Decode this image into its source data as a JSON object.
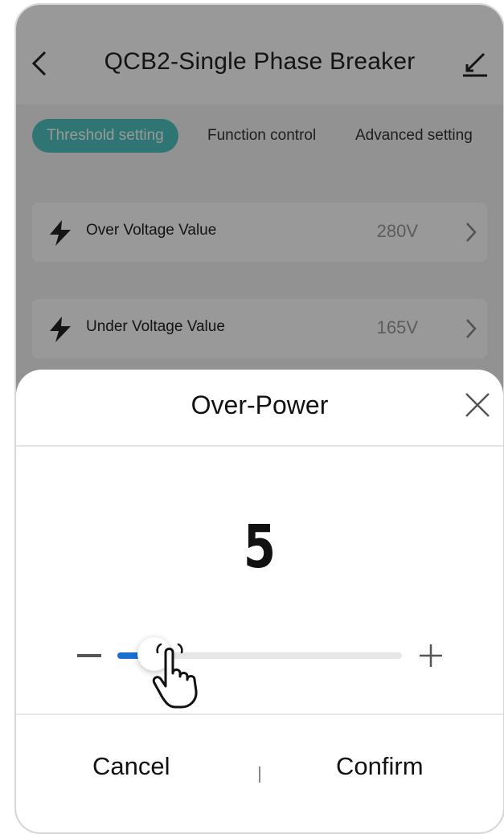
{
  "header": {
    "title": "QCB2-Single Phase Breaker",
    "back_icon": "chevron-left-icon",
    "edit_icon": "edit-pencil-icon"
  },
  "tabs": [
    {
      "label": "Threshold setting",
      "active": true
    },
    {
      "label": "Function control",
      "active": false
    },
    {
      "label": "Advanced setting",
      "active": false
    }
  ],
  "settings": [
    {
      "icon": "lightning-bolt-icon",
      "label": "Over Voltage Value",
      "value": "280V"
    },
    {
      "icon": "lightning-bolt-icon",
      "label": "Under Voltage Value",
      "value": "165V"
    }
  ],
  "dialog": {
    "title": "Over-Power",
    "value": "5",
    "slider_fraction": 0.13,
    "cancel_label": "Cancel",
    "confirm_label": "Confirm"
  },
  "colors": {
    "accent": "#4fc3c0",
    "slider_fill": "#1a6fd1",
    "overlay": "rgba(0,0,0,0.40)"
  }
}
